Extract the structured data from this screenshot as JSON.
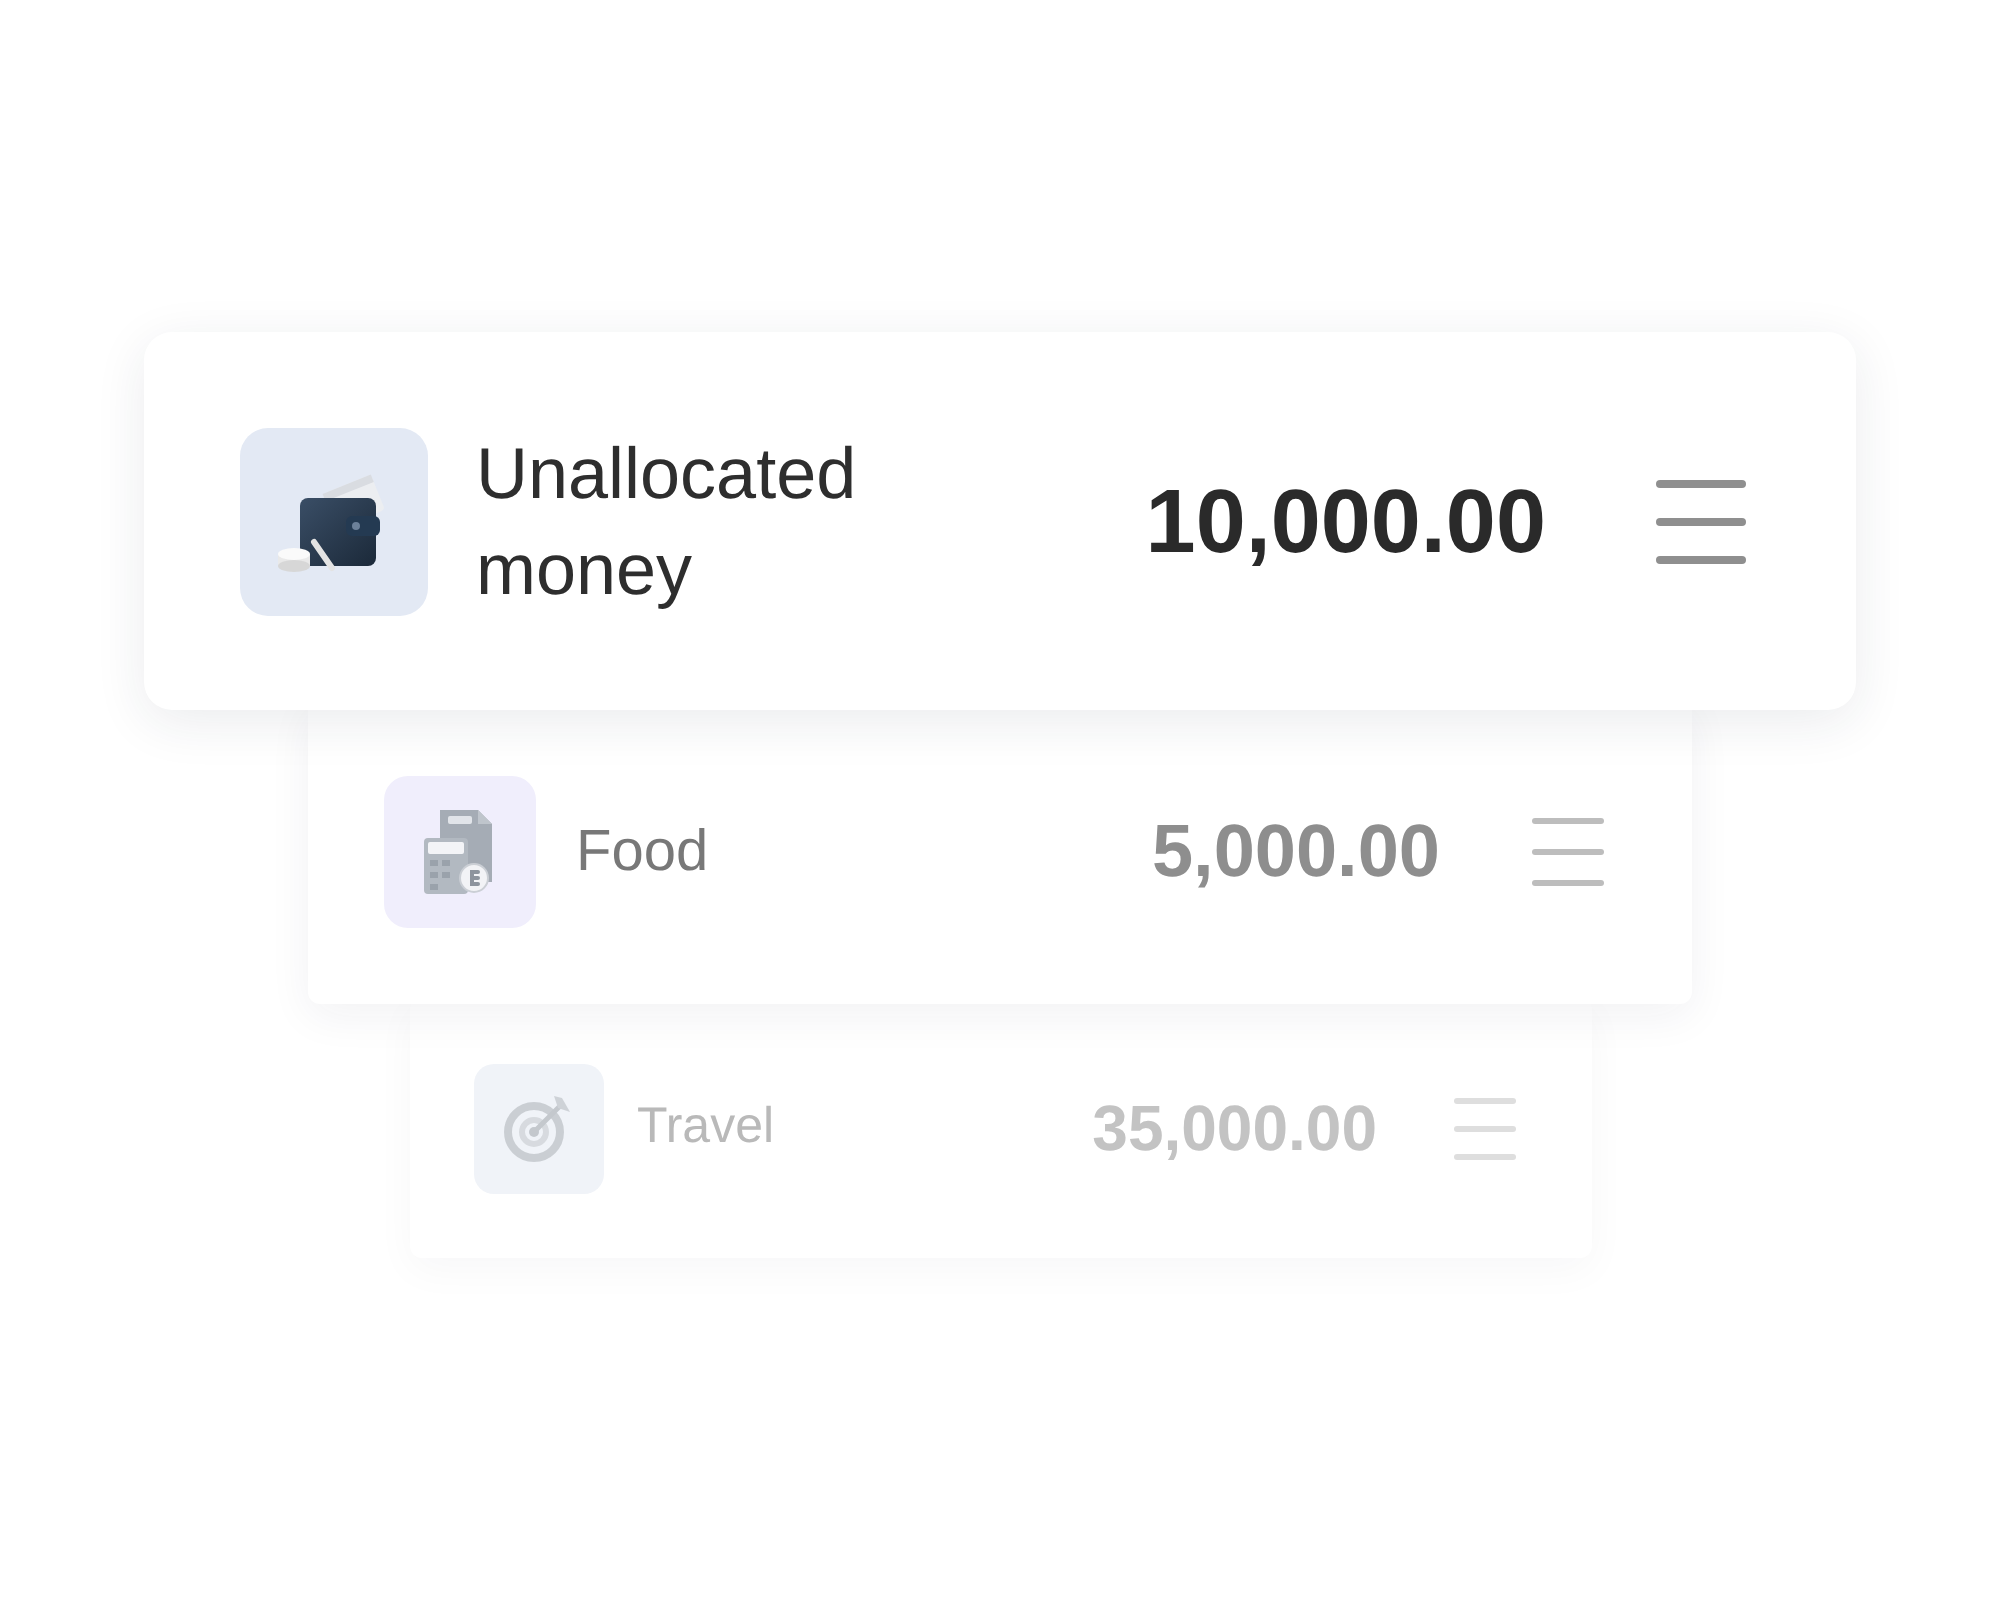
{
  "cards": [
    {
      "title": "Unallocated money",
      "amount": "10,000.00",
      "color": "#e3e9f4"
    },
    {
      "title": "Food",
      "amount": "5,000.00",
      "color": "#f0eefc"
    },
    {
      "title": "Travel",
      "amount": "35,000.00",
      "color": "#f0f3f8"
    }
  ]
}
